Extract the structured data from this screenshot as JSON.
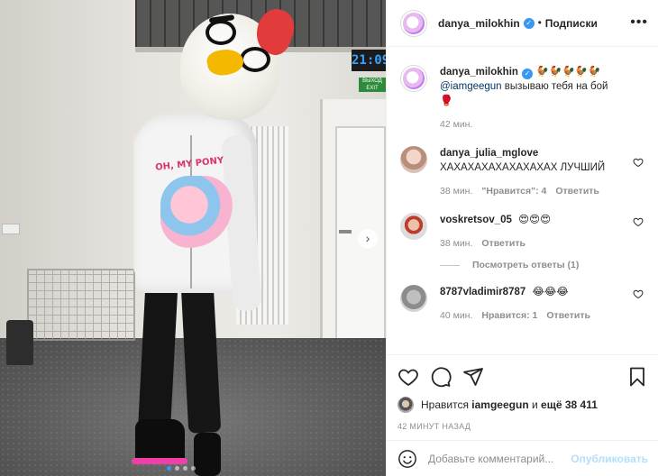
{
  "post": {
    "author": "danya_milokhin",
    "separator": "•",
    "follow_label": "Подписки",
    "more_label": "•••",
    "clock_text": "21:09",
    "exit_text": "ВЫХОД EXIT",
    "print_text": "OH, MY PONY"
  },
  "caption": {
    "user": "danya_milokhin",
    "emojis": "🐓🐓🐓🐓🐓",
    "mention": "@iamgeegun",
    "text": "вызываю тебя на бой",
    "glove": "🥊",
    "time": "42 мин."
  },
  "comments": [
    {
      "user": "danya_julia_mglove",
      "text": "ХАХАХАХАХАХАХАХАХ ЛУЧШИЙ",
      "time": "38 мин.",
      "likes": "\"Нравится\": 4",
      "reply": "Ответить"
    },
    {
      "user": "voskretsov_05",
      "text": "😍😍😍",
      "time": "38 мин.",
      "reply": "Ответить"
    },
    {
      "user": "8787vladimir8787",
      "text": "😂😂😂",
      "time": "40 мин.",
      "likes": "Нравится: 1",
      "reply": "Ответить"
    }
  ],
  "view_replies": "Посмотреть ответы (1)",
  "likes": {
    "prefix": "Нравится",
    "user": "iamgeegun",
    "and": "и",
    "count": "ещё 38 411"
  },
  "posted_ago": "42 МИНУТ НАЗАД",
  "comment_box": {
    "placeholder": "Добавьте комментарий...",
    "post_label": "Опубликовать"
  },
  "colors": {
    "accent": "#3897f0",
    "mention": "#00376b",
    "muted": "#8e8e8e",
    "post_disabled": "#b2dffc"
  },
  "icons": [
    "heart-icon",
    "comment-icon",
    "share-icon",
    "bookmark-icon",
    "smile-icon",
    "verified-icon",
    "next-arrow-icon",
    "more-icon"
  ]
}
